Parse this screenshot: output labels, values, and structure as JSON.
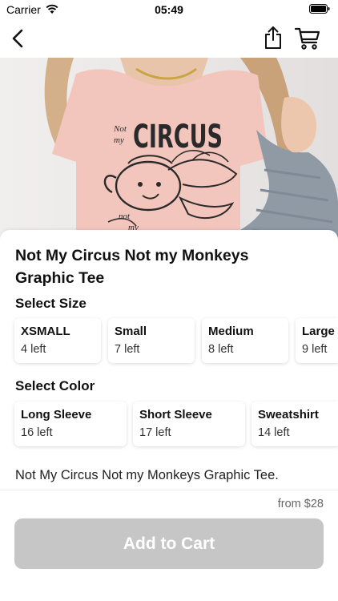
{
  "status_bar": {
    "carrier": "Carrier",
    "time": "05:49",
    "wifi_icon": "wifi-icon",
    "battery_icon": "battery-icon"
  },
  "nav_bar": {
    "back_icon": "chevron-left-icon",
    "share_icon": "share-icon",
    "cart_icon": "cart-icon"
  },
  "product": {
    "image_subject": "pink t-shirt with circus graphic",
    "title": "Not My Circus Not my Monkeys Graphic Tee",
    "description": "Not My Circus Not my Monkeys Graphic Tee.",
    "price_text": "from $28"
  },
  "size_section": {
    "heading": "Select Size",
    "options": [
      {
        "name": "XSMALL",
        "stock": "4 left"
      },
      {
        "name": "Small",
        "stock": "7 left"
      },
      {
        "name": "Medium",
        "stock": "8 left"
      },
      {
        "name": "Large",
        "stock": "9 left"
      }
    ]
  },
  "color_section": {
    "heading": "Select Color",
    "options": [
      {
        "name": "Long Sleeve",
        "stock": "16 left"
      },
      {
        "name": "Short Sleeve",
        "stock": "17 left"
      },
      {
        "name": "Sweatshirt",
        "stock": "14 left"
      }
    ]
  },
  "cart_button": {
    "label": "Add to Cart",
    "state": "disabled"
  },
  "colors": {
    "button_disabled": "#c6c6c6",
    "shirt_pink": "#f2c6bc",
    "sleeve_gray": "#8f9aa5"
  }
}
